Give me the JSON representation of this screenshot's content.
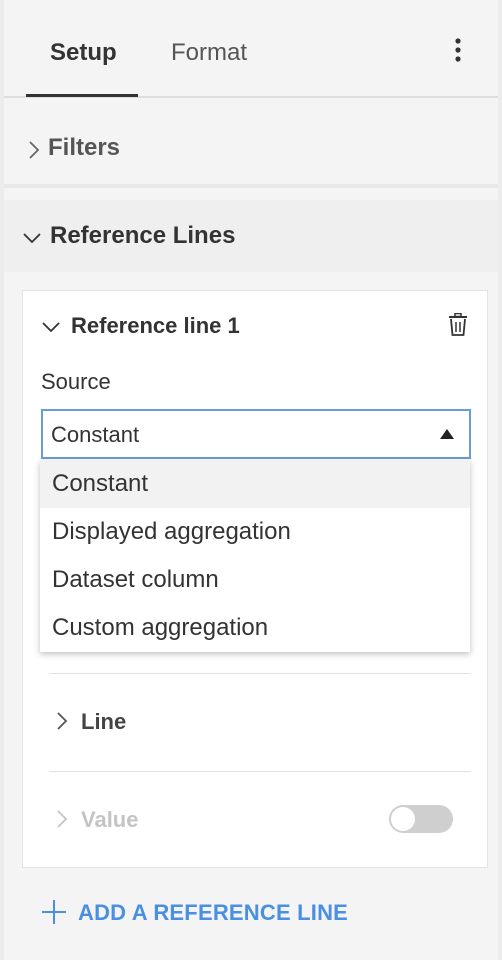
{
  "tabs": {
    "setup_label": "Setup",
    "format_label": "Format",
    "active": "Setup"
  },
  "more_icon": "vertical-ellipsis",
  "filters": {
    "label": "Filters",
    "icon": "chevron-right"
  },
  "reference_lines": {
    "label": "Reference Lines",
    "icon": "chevron-down",
    "card": {
      "title": "Reference line 1",
      "delete_icon": "trash",
      "source": {
        "label": "Source",
        "value": "Constant",
        "options": [
          "Constant",
          "Displayed aggregation",
          "Dataset column",
          "Custom aggregation"
        ],
        "open": true
      },
      "line_section": {
        "label": "Line"
      },
      "value_section": {
        "label": "Value",
        "toggle_on": false,
        "disabled": true
      }
    },
    "add_label": "ADD A REFERENCE LINE"
  },
  "colors": {
    "accent": "#4a90e2",
    "select_border": "#6b9cd8",
    "panel_bg": "#f4f4f4",
    "disabled_text": "#c4c4c4"
  }
}
